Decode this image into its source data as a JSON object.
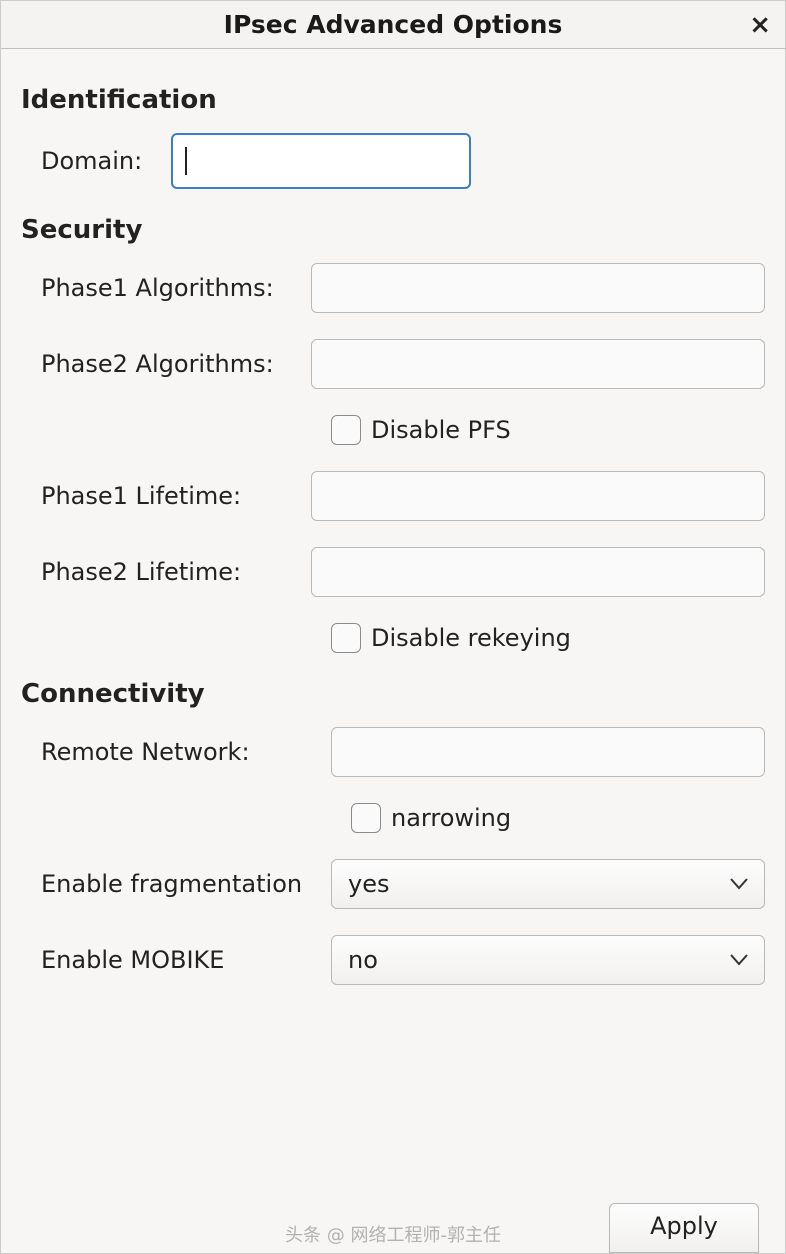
{
  "title": "IPsec Advanced Options",
  "sections": {
    "identification": {
      "heading": "Identification",
      "domain_label": "Domain:",
      "domain_value": ""
    },
    "security": {
      "heading": "Security",
      "phase1_alg_label": "Phase1 Algorithms:",
      "phase1_alg_value": "",
      "phase2_alg_label": "Phase2 Algorithms:",
      "phase2_alg_value": "",
      "disable_pfs_label": "Disable PFS",
      "disable_pfs_checked": false,
      "phase1_life_label": "Phase1 Lifetime:",
      "phase1_life_value": "",
      "phase2_life_label": "Phase2 Lifetime:",
      "phase2_life_value": "",
      "disable_rekey_label": "Disable rekeying",
      "disable_rekey_checked": false
    },
    "connectivity": {
      "heading": "Connectivity",
      "remote_net_label": "Remote Network:",
      "remote_net_value": "",
      "narrowing_label": "narrowing",
      "narrowing_checked": false,
      "fragmentation_label": "Enable fragmentation",
      "fragmentation_value": "yes",
      "mobike_label": "Enable MOBIKE",
      "mobike_value": "no"
    }
  },
  "footer": {
    "apply_label": "Apply"
  },
  "watermark": "头条 @ 网络工程师-郭主任"
}
